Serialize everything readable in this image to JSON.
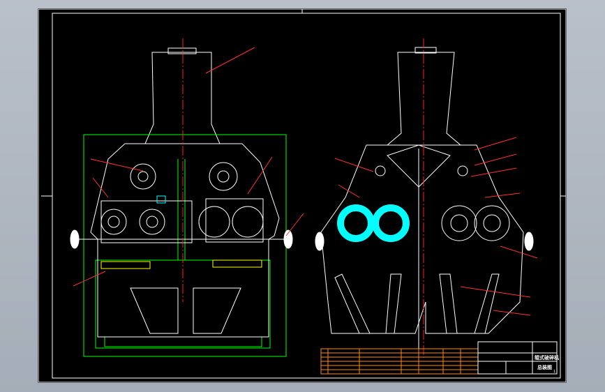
{
  "drawing": {
    "title_block": {
      "drawing_name": "总装图",
      "machine_name": "辊式破碎机",
      "sheet": "1"
    },
    "colors": {
      "background": "#000000",
      "outline": "#ffffff",
      "centerline": "#ff2020",
      "frame": "#00ff00",
      "parts": "#ffff00",
      "roll": "#00ffff",
      "title_block": "#ff8c00",
      "leader": "#ff3030"
    },
    "views": [
      "front-section-view",
      "side-section-view"
    ]
  }
}
